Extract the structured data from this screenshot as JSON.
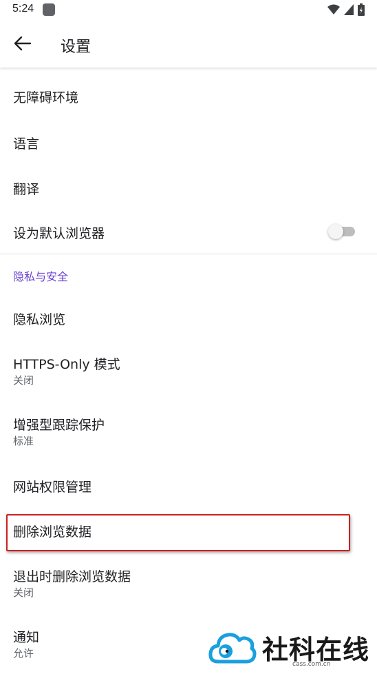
{
  "status_bar": {
    "time": "5:24",
    "icons": [
      "app-notification-icon",
      "wifi-icon",
      "signal-icon",
      "battery-icon"
    ]
  },
  "app_bar": {
    "back_icon": "arrow-left-icon",
    "title": "设置"
  },
  "settings": {
    "items_top": [
      {
        "title": "无障碍环境"
      },
      {
        "title": "语言"
      },
      {
        "title": "翻译"
      },
      {
        "title": "设为默认浏览器",
        "toggle": false
      }
    ],
    "privacy_section": {
      "header": "隐私与安全",
      "items": [
        {
          "title": "隐私浏览"
        },
        {
          "title": "HTTPS-Only 模式",
          "subtitle": "关闭"
        },
        {
          "title": "增强型跟踪保护",
          "subtitle": "标准"
        },
        {
          "title": "网站权限管理"
        },
        {
          "title": "删除浏览数据",
          "highlighted": true
        },
        {
          "title": "退出时删除浏览数据",
          "subtitle": "关闭"
        },
        {
          "title": "通知",
          "subtitle": "允许"
        }
      ]
    }
  },
  "watermark": {
    "text": "社科在线",
    "url": "cass.com.cn"
  },
  "colors": {
    "section_header": "#6a3fd0",
    "highlight_border": "#d01e1e",
    "switch_track_off": "#bdbdbd"
  }
}
